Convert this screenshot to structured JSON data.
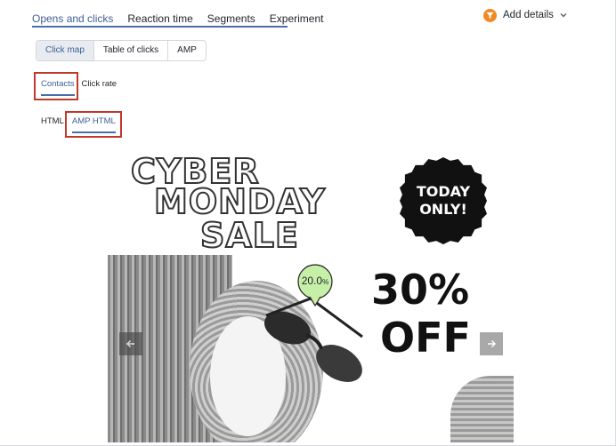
{
  "top_tabs": [
    {
      "label": "Opens and clicks",
      "active": true
    },
    {
      "label": "Reaction time",
      "active": false
    },
    {
      "label": "Segments",
      "active": false
    },
    {
      "label": "Experiment",
      "active": false
    }
  ],
  "add_details": {
    "label": "Add details",
    "icon": "funnel-icon",
    "color": "#f08a24"
  },
  "view_switch": [
    {
      "label": "Click map",
      "active": true
    },
    {
      "label": "Table of clicks",
      "active": false
    },
    {
      "label": "AMP",
      "active": false
    }
  ],
  "metric_tabs": [
    {
      "label": "Contacts",
      "active": true
    },
    {
      "label": "Click rate",
      "active": false
    }
  ],
  "format_tabs": [
    {
      "label": "HTML",
      "active": false
    },
    {
      "label": "AMP HTML",
      "active": true
    }
  ],
  "preview": {
    "headline": [
      "CYBER",
      "MONDAY",
      "SALE"
    ],
    "badge": [
      "TODAY",
      "ONLY!"
    ],
    "discount": [
      "30%",
      "OFF"
    ],
    "click_percent": "20.0",
    "click_percent_unit": "%"
  },
  "colors": {
    "accent": "#3d5f96",
    "highlight": "#c0392b",
    "bubble": "#c6f0a8"
  }
}
